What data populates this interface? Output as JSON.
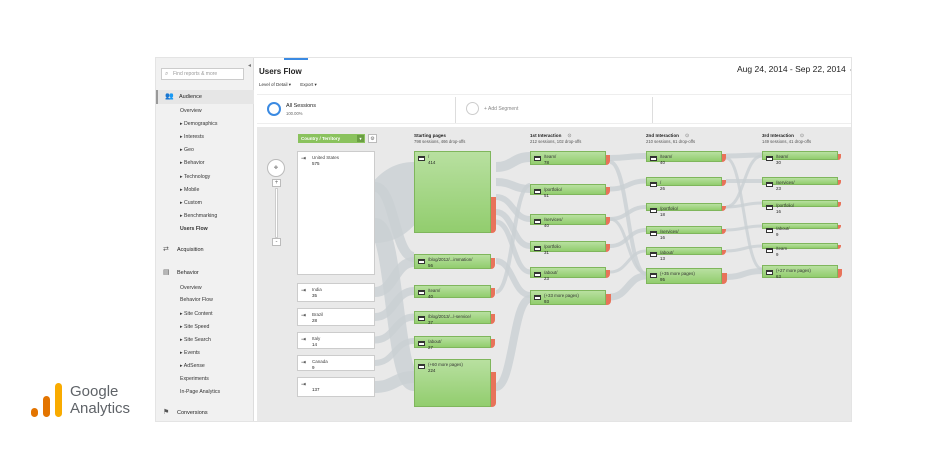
{
  "sidebar": {
    "search_placeholder": "Find reports & more",
    "sections": [
      {
        "label": "Audience",
        "icon": "people-icon"
      },
      {
        "label": "Acquisition",
        "icon": "acquisition-icon"
      },
      {
        "label": "Behavior",
        "icon": "behavior-icon"
      },
      {
        "label": "Conversions",
        "icon": "flag-icon"
      }
    ],
    "audience_items": [
      "Overview",
      "▸ Demographics",
      "▸ Interests",
      "▸ Geo",
      "▸ Behavior",
      "▸ Technology",
      "▸ Mobile",
      "▸ Custom",
      "▸ Benchmarking",
      "Users Flow"
    ],
    "behavior_items": [
      "Overview",
      "Behavior Flow",
      "▸ Site Content",
      "▸ Site Speed",
      "▸ Site Search",
      "▸ Events",
      "▸ AdSense",
      "Experiments",
      "In-Page Analytics"
    ]
  },
  "header": {
    "title": "Users Flow",
    "date_range": "Aug 24, 2014 - Sep 22, 2014",
    "level_of_detail": "Level of Detail ▾",
    "export": "Export ▾"
  },
  "segments": {
    "all_sessions": "All Sessions",
    "all_sessions_pct": "100.00%",
    "add_segment": "+ Add Segment"
  },
  "flow": {
    "dimension": "Country / Territory",
    "columns": [
      {
        "title": "Starting pages",
        "sub": "798 sessions, 466 drop-offs"
      },
      {
        "title": "1st Interaction",
        "sub": "212 sessions, 102 drop-offs"
      },
      {
        "title": "2nd Interaction",
        "sub": "210 sessions, 61 drop-offs"
      },
      {
        "title": "3rd Interaction",
        "sub": "149 sessions, 41 drop-offs"
      }
    ],
    "countries": [
      {
        "name": "United States",
        "count": "575"
      },
      {
        "name": "India",
        "count": "35"
      },
      {
        "name": "Brazil",
        "count": "28"
      },
      {
        "name": "Italy",
        "count": "14"
      },
      {
        "name": "Canada",
        "count": "9"
      },
      {
        "name": "",
        "count": "137"
      }
    ],
    "starting_pages": [
      {
        "name": "/",
        "count": "414"
      },
      {
        "name": "/blog/2012/...immation/",
        "count": "56"
      },
      {
        "name": "/team/",
        "count": "40"
      },
      {
        "name": "/blog/2013/...l-service/",
        "count": "37"
      },
      {
        "name": "/about/",
        "count": "27"
      },
      {
        "name": "(+60 more pages)",
        "count": "224"
      }
    ],
    "interaction_1": [
      {
        "name": "/team/",
        "count": "78"
      },
      {
        "name": "/portfolio/",
        "count": "51"
      },
      {
        "name": "/services/",
        "count": "40"
      },
      {
        "name": "/portfolio",
        "count": "31"
      },
      {
        "name": "/about/",
        "count": "23"
      },
      {
        "name": "(+33 more pages)",
        "count": "93"
      }
    ],
    "interaction_2": [
      {
        "name": "/team/",
        "count": "40"
      },
      {
        "name": "/",
        "count": "26"
      },
      {
        "name": "/portfolio/",
        "count": "18"
      },
      {
        "name": "/services/",
        "count": "16"
      },
      {
        "name": "/about/",
        "count": "13"
      },
      {
        "name": "(+35 more pages)",
        "count": "95"
      }
    ],
    "interaction_3": [
      {
        "name": "/team/",
        "count": "30"
      },
      {
        "name": "/services/",
        "count": "23"
      },
      {
        "name": "/portfolio/",
        "count": "16"
      },
      {
        "name": "/about/",
        "count": "9"
      },
      {
        "name": "/team",
        "count": "9"
      },
      {
        "name": "(+27 more pages)",
        "count": "63"
      }
    ]
  },
  "logo": {
    "line1": "Google",
    "line2": "Analytics"
  },
  "colors": {
    "node_green": "#92cd6e",
    "dropoff_red": "#e8735a",
    "accent_blue": "#3b8ae2",
    "logo_orange": "#f9ab00",
    "logo_dark_orange": "#e37400"
  }
}
